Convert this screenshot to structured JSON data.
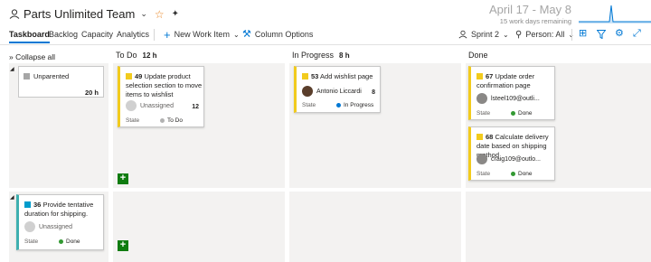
{
  "header": {
    "team_name": "Parts Unlimited Team",
    "sprint_dates": "April 17 - May 8",
    "work_days": "15 work days remaining"
  },
  "toolbar": {
    "tabs": [
      "Taskboard",
      "Backlog",
      "Capacity",
      "Analytics"
    ],
    "new_work_item": "New Work Item",
    "column_options": "Column Options",
    "sprint": "Sprint 2",
    "person": "Person: All"
  },
  "columns": {
    "collapse_all": "Collapse all",
    "todo": "To Do",
    "todo_hours": "12 h",
    "inprogress": "In Progress",
    "inprogress_hours": "8 h",
    "done": "Done"
  },
  "rows": [
    {
      "parent": {
        "title": "Unparented",
        "hours": "20 h"
      },
      "todo": [
        {
          "id": "49",
          "title": "Update product selection section to move items to wishlist",
          "assignee": "Unassigned",
          "remaining": "12",
          "state_label": "State",
          "state": "To Do",
          "state_color": "#b2b2b2"
        }
      ],
      "inprogress": [
        {
          "id": "53",
          "title": "Add wishlist page",
          "assignee": "Antonio Liccardi",
          "remaining": "8",
          "state_label": "State",
          "state": "In Progress",
          "state_color": "#0078d4"
        }
      ],
      "done": [
        {
          "id": "67",
          "title": "Update order confirmation page",
          "assignee": "lsteel109@outli...",
          "state_label": "State",
          "state": "Done",
          "state_color": "#339933"
        },
        {
          "id": "68",
          "title": "Calculate delivery date based on shipping method",
          "assignee": "craig109@outlo...",
          "state_label": "State",
          "state": "Done",
          "state_color": "#339933"
        }
      ]
    },
    {
      "parent": {
        "id": "36",
        "title": "Provide tentative duration for shipping.",
        "assignee": "Unassigned",
        "state_label": "State",
        "state": "Done",
        "state_color": "#339933"
      }
    }
  ]
}
